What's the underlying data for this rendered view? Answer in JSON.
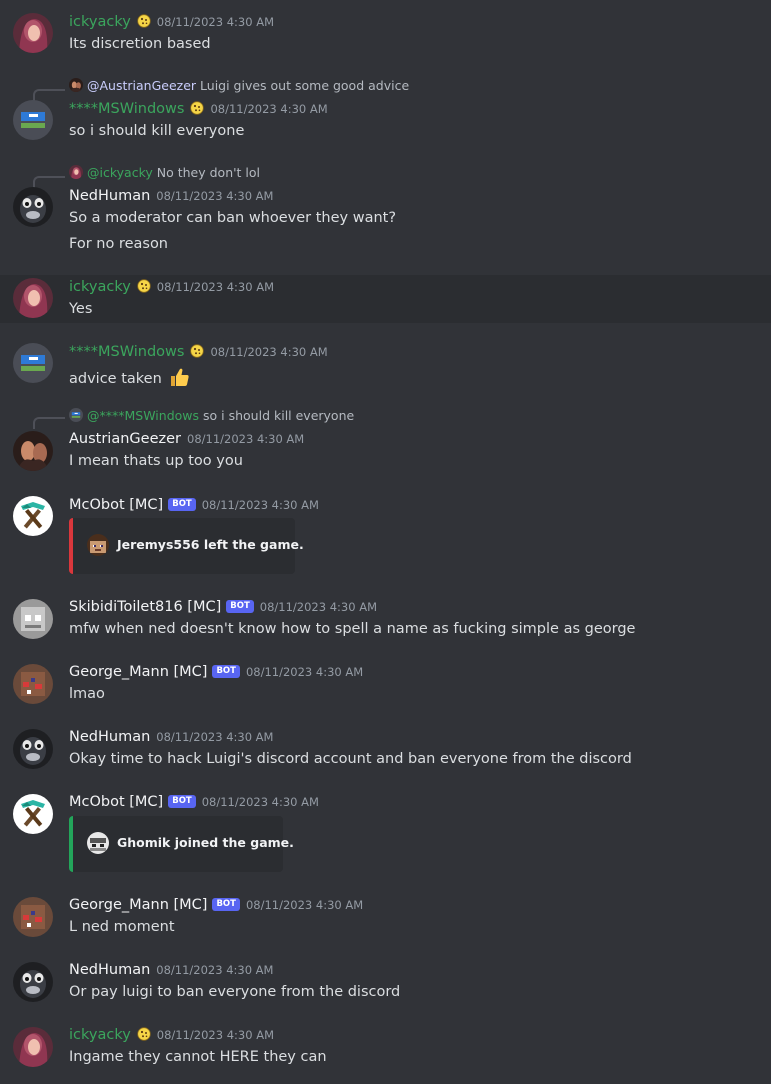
{
  "colors": {
    "green_name": "#3ba55d",
    "white_name": "#f2f3f5",
    "background": "#313338",
    "highlight": "#2b2d31",
    "bot_badge": "#5865f2"
  },
  "messages": [
    {
      "author": "ickyacky",
      "timestamp": "08/11/2023 4:30 AM",
      "text": "Its discretion based",
      "badge_icon": "cookie-icon"
    },
    {
      "reply_to": "@AustrianGeezer",
      "reply_text": "Luigi gives out some good advice",
      "author": "****MSWindows",
      "timestamp": "08/11/2023 4:30 AM",
      "text": "so i should kill everyone",
      "badge_icon": "cookie-icon"
    },
    {
      "reply_to": "@ickyacky",
      "reply_text": "No they don't lol",
      "author": "NedHuman",
      "timestamp": "08/11/2023 4:30 AM",
      "text": "So a moderator can ban whoever they want?",
      "text2": "For no reason"
    },
    {
      "author": "ickyacky",
      "timestamp": "08/11/2023 4:30 AM",
      "text": "Yes",
      "badge_icon": "cookie-icon"
    },
    {
      "author": "****MSWindows",
      "timestamp": "08/11/2023 4:30 AM",
      "text": "advice taken",
      "badge_icon": "cookie-icon",
      "emoji": "thumbs-up-icon"
    },
    {
      "reply_to": "@****MSWindows",
      "reply_text": "so i should kill everyone",
      "author": "AustrianGeezer",
      "timestamp": "08/11/2023 4:30 AM",
      "text": "I mean thats up too you"
    },
    {
      "author": "McObot [MC]",
      "bot": "BOT",
      "timestamp": "08/11/2023 4:30 AM",
      "embed": "Jeremys556 left the game."
    },
    {
      "author": "SkibidiToilet816 [MC]",
      "bot": "BOT",
      "timestamp": "08/11/2023 4:30 AM",
      "text": "mfw when ned doesn't know how to spell a name as fucking simple as george"
    },
    {
      "author": "George_Mann [MC]",
      "bot": "BOT",
      "timestamp": "08/11/2023 4:30 AM",
      "text": "lmao"
    },
    {
      "author": "NedHuman",
      "timestamp": "08/11/2023 4:30 AM",
      "text": "Okay time to hack Luigi's discord account and ban everyone from the discord"
    },
    {
      "author": "McObot [MC]",
      "bot": "BOT",
      "timestamp": "08/11/2023 4:30 AM",
      "embed": "Ghomik joined the game."
    },
    {
      "author": "George_Mann [MC]",
      "bot": "BOT",
      "timestamp": "08/11/2023 4:30 AM",
      "text": "L ned moment"
    },
    {
      "author": "NedHuman",
      "timestamp": "08/11/2023 4:30 AM",
      "text": "Or pay luigi to ban everyone from the discord"
    },
    {
      "author": "ickyacky",
      "timestamp": "08/11/2023 4:30 AM",
      "text": "Ingame they cannot HERE they can",
      "badge_icon": "cookie-icon"
    }
  ]
}
